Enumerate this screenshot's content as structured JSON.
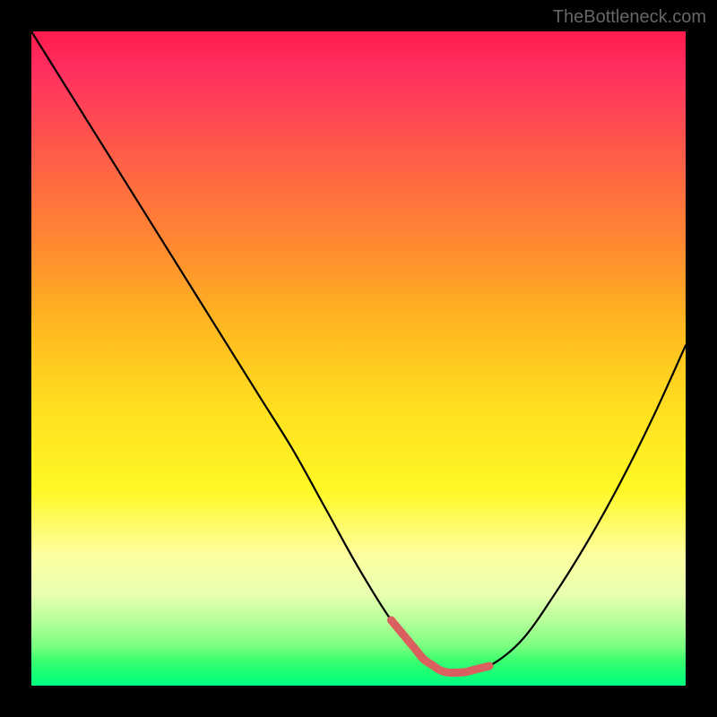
{
  "watermark": "TheBottleneck.com",
  "chart_data": {
    "type": "line",
    "title": "",
    "xlabel": "",
    "ylabel": "",
    "x": [
      0.0,
      0.05,
      0.1,
      0.15,
      0.2,
      0.25,
      0.3,
      0.35,
      0.4,
      0.45,
      0.5,
      0.55,
      0.6,
      0.63,
      0.66,
      0.7,
      0.75,
      0.8,
      0.85,
      0.9,
      0.95,
      1.0
    ],
    "values": [
      1.0,
      0.92,
      0.84,
      0.76,
      0.68,
      0.6,
      0.52,
      0.44,
      0.36,
      0.27,
      0.18,
      0.1,
      0.04,
      0.02,
      0.02,
      0.03,
      0.07,
      0.14,
      0.22,
      0.31,
      0.41,
      0.52
    ],
    "xlim": [
      0,
      1
    ],
    "ylim": [
      0,
      1
    ],
    "gradient": {
      "top": "#ff1a4d",
      "mid_upper": "#ff8a30",
      "mid": "#ffe020",
      "mid_lower": "#fdffa0",
      "bottom": "#00ff80"
    },
    "highlight_segment": {
      "x_range": [
        0.55,
        0.7
      ],
      "color": "#d9605e",
      "width": 9
    }
  }
}
